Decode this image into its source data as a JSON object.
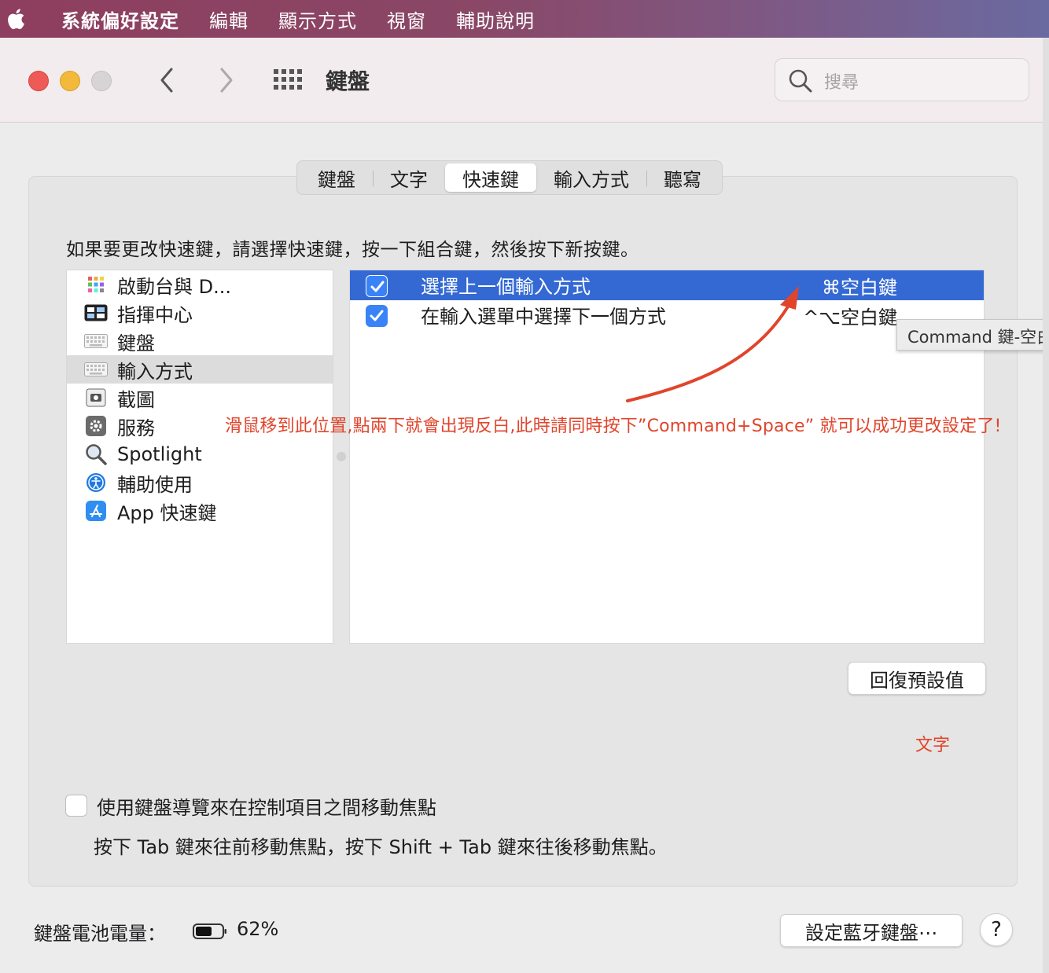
{
  "menubar": {
    "apple_icon": "apple-logo-icon",
    "app_name": "系統偏好設定",
    "items": [
      "編輯",
      "顯示方式",
      "視窗",
      "輔助說明"
    ]
  },
  "window": {
    "title": "鍵盤",
    "search_placeholder": "搜尋"
  },
  "tabs": [
    {
      "label": "鍵盤",
      "active": false
    },
    {
      "label": "文字",
      "active": false
    },
    {
      "label": "快速鍵",
      "active": true
    },
    {
      "label": "輸入方式",
      "active": false
    },
    {
      "label": "聽寫",
      "active": false
    }
  ],
  "instruction": "如果要更改快速鍵，請選擇快速鍵，按一下組合鍵，然後按下新按鍵。",
  "categories": [
    {
      "label": "啟動台與 D...",
      "icon": "launchpad-icon",
      "selected": false
    },
    {
      "label": "指揮中心",
      "icon": "mission-control-icon",
      "selected": false
    },
    {
      "label": "鍵盤",
      "icon": "keyboard-icon",
      "selected": false
    },
    {
      "label": "輸入方式",
      "icon": "keyboard-icon",
      "selected": true
    },
    {
      "label": "截圖",
      "icon": "screenshot-icon",
      "selected": false
    },
    {
      "label": "服務",
      "icon": "gear-icon",
      "selected": false
    },
    {
      "label": "Spotlight",
      "icon": "magnifier-icon",
      "selected": false
    },
    {
      "label": "輔助使用",
      "icon": "accessibility-icon",
      "selected": false
    },
    {
      "label": "App 快速鍵",
      "icon": "app-store-icon",
      "selected": false
    }
  ],
  "shortcuts": [
    {
      "label": "選擇上一個輸入方式",
      "key": "⌘空白鍵",
      "checked": true,
      "selected": true
    },
    {
      "label": "在輸入選單中選擇下一個方式",
      "key": "^⌥空白鍵",
      "checked": true,
      "selected": false
    }
  ],
  "tooltip": "Command 鍵-空白",
  "annotation": {
    "text": "滑鼠移到此位置,點兩下就會出現反白,此時請同時按下”Command+Space” 就可以成功更改設定了!",
    "small_text": "文字",
    "color": "#e0452c"
  },
  "restore_button": "回復預設值",
  "keyboard_navigation": {
    "label": "使用鍵盤導覽來在控制項目之間移動焦點",
    "checked": false,
    "description": "按下 Tab 鍵來往前移動焦點，按下 Shift + Tab 鍵來往後移動焦點。"
  },
  "battery": {
    "label": "鍵盤電池電量：",
    "percent_text": "62%",
    "level": 0.62
  },
  "bluetooth_button": "設定藍牙鍵盤⋯",
  "help_button": "?",
  "colors": {
    "selection": "#3469d4",
    "checkbox": "#3a82f7",
    "close": "#ee5b56",
    "minimize": "#f2b93a"
  }
}
